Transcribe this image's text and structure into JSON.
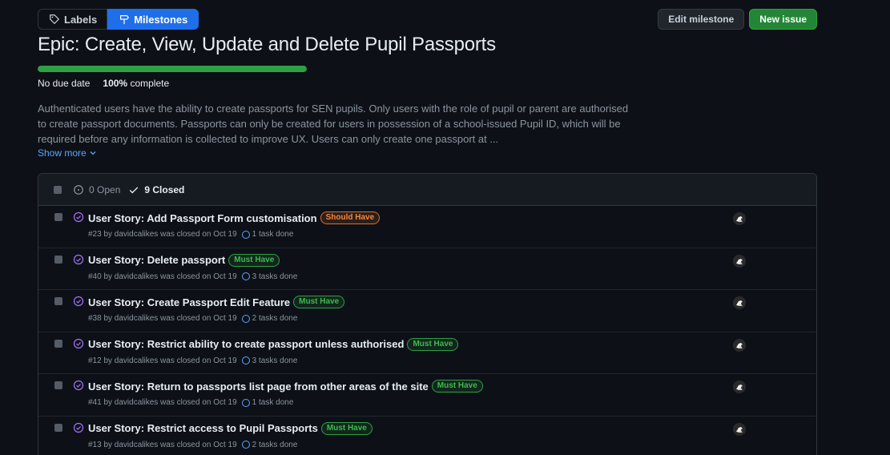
{
  "nav": {
    "labels": "Labels",
    "milestones": "Milestones"
  },
  "actions": {
    "edit": "Edit milestone",
    "new_issue": "New issue"
  },
  "milestone": {
    "title": "Epic: Create, View, Update and Delete Pupil Passports",
    "due": "No due date",
    "percent_complete": "100%",
    "complete_suffix": "complete",
    "progress_fraction": 1.0,
    "description": "Authenticated users have the ability to create passports for SEN pupils. Only users with the role of pupil or parent are authorised to create passport documents. Passports can only be created for users in possession of a school-issued Pupil ID, which will be required before any information is collected to improve UX. Users can only create one passport at ...",
    "show_more": "Show more"
  },
  "filters": {
    "open": "0 Open",
    "closed": "9 Closed"
  },
  "issues": [
    {
      "title": "User Story: Add Passport Form customisation",
      "label": "Should Have",
      "label_type": "should",
      "number": "#23",
      "meta": "by davidcalikes was closed on Oct 19",
      "tasks": "1 task done"
    },
    {
      "title": "User Story: Delete passport",
      "label": "Must Have",
      "label_type": "must",
      "number": "#40",
      "meta": "by davidcalikes was closed on Oct 19",
      "tasks": "3 tasks done"
    },
    {
      "title": "User Story: Create Passport Edit Feature",
      "label": "Must Have",
      "label_type": "must",
      "number": "#38",
      "meta": "by davidcalikes was closed on Oct 19",
      "tasks": "2 tasks done"
    },
    {
      "title": "User Story: Restrict ability to create passport unless authorised",
      "label": "Must Have",
      "label_type": "must",
      "number": "#12",
      "meta": "by davidcalikes was closed on Oct 19",
      "tasks": "3 tasks done"
    },
    {
      "title": "User Story: Return to passports list page from other areas of the site",
      "label": "Must Have",
      "label_type": "must",
      "number": "#41",
      "meta": "by davidcalikes was closed on Oct 19",
      "tasks": "1 task done"
    },
    {
      "title": "User Story: Restrict access to Pupil Passports",
      "label": "Must Have",
      "label_type": "must",
      "number": "#13",
      "meta": "by davidcalikes was closed on Oct 19",
      "tasks": "2 tasks done"
    }
  ],
  "colors": {
    "background": "#0d1117",
    "accent": "#1f6feb",
    "success": "#238636",
    "closed_icon": "#a371f7",
    "must_label": "#3fb950",
    "should_label": "#f0883e"
  },
  "icons": {
    "labels": "tag-icon",
    "milestones": "milestone-icon",
    "open": "issue-opened-icon",
    "closed": "check-icon",
    "issue": "issue-closed-icon",
    "chevron": "chevron-down-icon"
  }
}
